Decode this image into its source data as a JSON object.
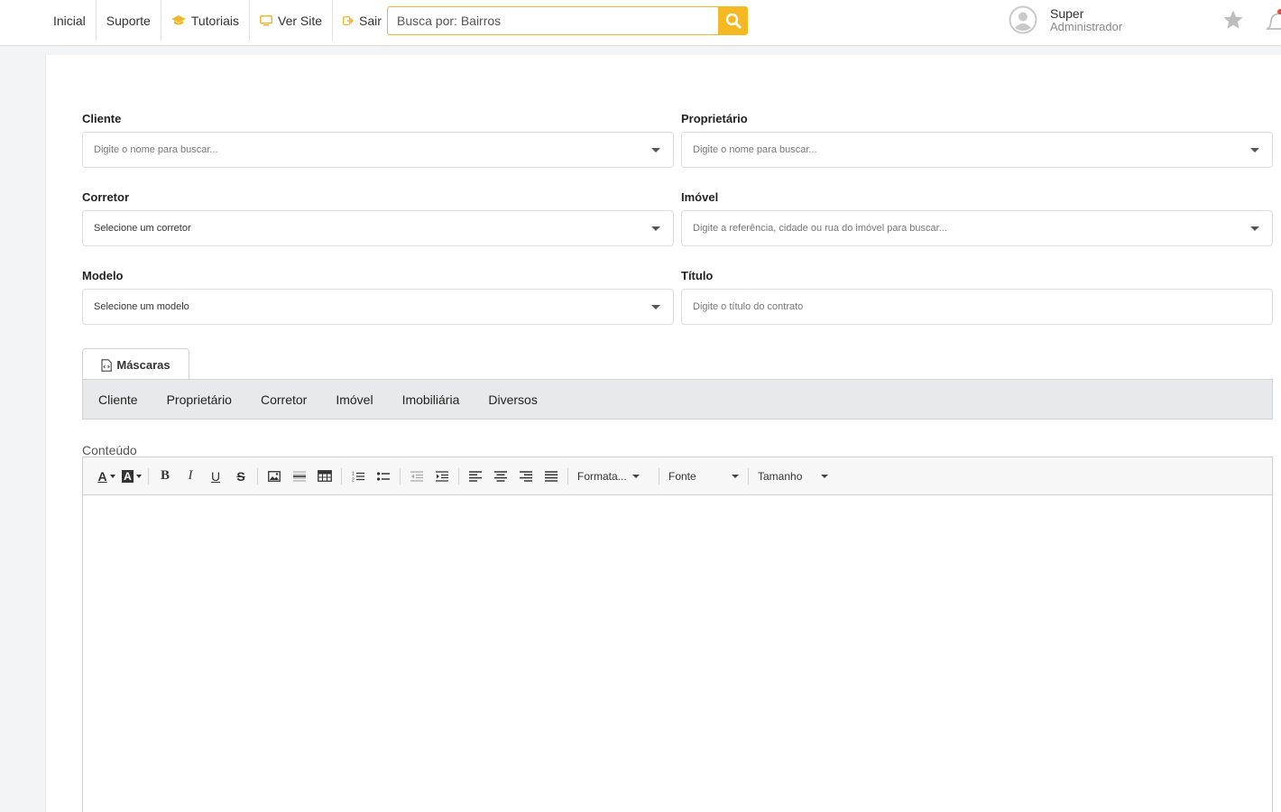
{
  "nav": {
    "items": [
      {
        "label": "Inicial",
        "icon": ""
      },
      {
        "label": "Suporte",
        "icon": ""
      },
      {
        "label": "Tutoriais",
        "icon": "graduation-cap-icon"
      },
      {
        "label": "Ver Site",
        "icon": "monitor-icon"
      },
      {
        "label": "Sair",
        "icon": "sign-out-icon"
      }
    ]
  },
  "search": {
    "placeholder": "Busca por: Bairros",
    "icon": "search-icon"
  },
  "user": {
    "name": "Super",
    "role": "Administrador"
  },
  "colors": {
    "accent": "#f5b823",
    "masks_bar": "#e7e9ec"
  },
  "form": {
    "cliente": {
      "label": "Cliente",
      "placeholder": "Digite o nome para buscar..."
    },
    "proprietario": {
      "label": "Proprietário",
      "placeholder": "Digite o nome para buscar..."
    },
    "corretor": {
      "label": "Corretor",
      "value": "Selecione um corretor"
    },
    "imovel": {
      "label": "Imóvel",
      "placeholder": "Digite a referência, cidade ou rua do imóvel para buscar..."
    },
    "modelo": {
      "label": "Modelo",
      "value": "Selecione um modelo"
    },
    "titulo": {
      "label": "Título",
      "placeholder": "Digite o título do contrato"
    }
  },
  "masks": {
    "tab_label": "Máscaras",
    "items": [
      "Cliente",
      "Proprietário",
      "Corretor",
      "Imóvel",
      "Imobiliária",
      "Diversos"
    ]
  },
  "editor": {
    "label": "Conteúdo",
    "format_label": "Formata...",
    "font_label": "Fonte",
    "size_label": "Tamanho",
    "bold": "B",
    "italic": "I",
    "underline": "U",
    "strike": "S",
    "font_color_glyph": "A",
    "bg_color_glyph": "A"
  }
}
